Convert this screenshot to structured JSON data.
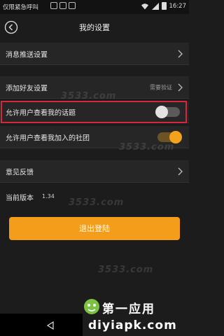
{
  "status_bar": {
    "carrier": "仅限紧急呼叫",
    "time": "16:27"
  },
  "header": {
    "title": "我的设置"
  },
  "settings": {
    "push_label": "消息推送设置",
    "add_friend_label": "添加好友设置",
    "add_friend_value": "需要验证",
    "topics_label": "允许用户查看我的话题",
    "topics_enabled": false,
    "clubs_label": "允许用户查看我加入的社团",
    "clubs_enabled": true,
    "feedback_label": "意见反馈",
    "version_label": "当前版本",
    "version_value": "1.34"
  },
  "logout_label": "退出登陆",
  "watermark": {
    "site": "3533.com",
    "brand_title": "第一应用",
    "brand_url": "diyiapk.com"
  },
  "colors": {
    "accent": "#f39d1a",
    "highlight": "#d7253c",
    "background": "#1c1c1c",
    "row": "#262626"
  }
}
